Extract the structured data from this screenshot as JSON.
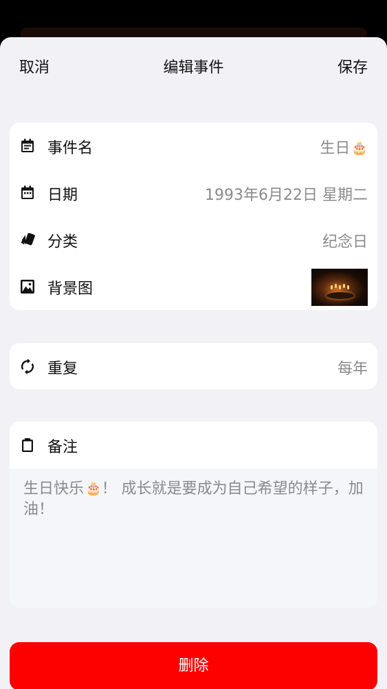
{
  "nav": {
    "cancel_label": "取消",
    "title": "编辑事件",
    "save_label": "保存"
  },
  "event": {
    "name_label": "事件名",
    "name_value": "生日",
    "name_emoji": "🎂",
    "date_label": "日期",
    "date_value": "1993年6月22日 星期二",
    "category_label": "分类",
    "category_value": "纪念日",
    "background_label": "背景图",
    "background_image": "birthday-cake-with-candles-photo"
  },
  "repeat": {
    "label": "重复",
    "value": "每年"
  },
  "notes": {
    "label": "备注",
    "text_before": "生日快乐",
    "emoji": "🎂",
    "text_after": "！ 成长就是要成为自己希望的样子，加油！"
  },
  "delete_label": "删除",
  "colors": {
    "background": "#f2f2f6",
    "card": "#ffffff",
    "secondary_text": "#8a8a8e",
    "delete": "#fd0000"
  },
  "icons": {
    "event_name": "calendar-text-icon",
    "date": "calendar-icon",
    "category": "cards-icon",
    "background": "image-icon",
    "repeat": "sync-icon",
    "notes": "clipboard-icon"
  }
}
